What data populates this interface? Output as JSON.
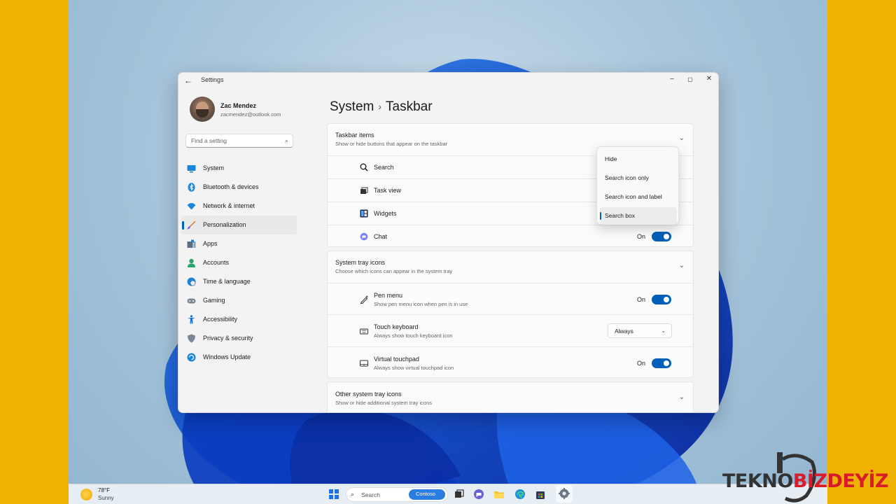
{
  "window": {
    "title": "Settings",
    "controls": {
      "minimize": "–",
      "maximize": "▢",
      "close": "✕"
    }
  },
  "profile": {
    "name": "Zac Mendez",
    "email": "zacmendez@outlook.com"
  },
  "search": {
    "placeholder": "Find a setting"
  },
  "nav": [
    {
      "label": "System",
      "icon": "system-icon",
      "color": "#1a86d9"
    },
    {
      "label": "Bluetooth & devices",
      "icon": "bluetooth-icon",
      "color": "#1a86d9"
    },
    {
      "label": "Network & internet",
      "icon": "network-icon",
      "color": "#1a86d9"
    },
    {
      "label": "Personalization",
      "icon": "brush-icon",
      "color": "#e07a2a",
      "active": true
    },
    {
      "label": "Apps",
      "icon": "apps-icon",
      "color": "#5a6f86"
    },
    {
      "label": "Accounts",
      "icon": "accounts-icon",
      "color": "#2aa56b"
    },
    {
      "label": "Time & language",
      "icon": "globe-clock-icon",
      "color": "#1a86d9"
    },
    {
      "label": "Gaming",
      "icon": "gamepad-icon",
      "color": "#7a8794"
    },
    {
      "label": "Accessibility",
      "icon": "accessibility-icon",
      "color": "#1a6fd9"
    },
    {
      "label": "Privacy & security",
      "icon": "shield-icon",
      "color": "#7a8794"
    },
    {
      "label": "Windows Update",
      "icon": "update-icon",
      "color": "#1a86d9"
    }
  ],
  "breadcrumb": {
    "parent": "System",
    "separator": "›",
    "current": "Taskbar"
  },
  "sections": {
    "taskbar_items": {
      "title": "Taskbar items",
      "subtitle": "Show or hide buttons that appear on the taskbar",
      "rows": [
        {
          "label": "Search",
          "icon": "search-icon"
        },
        {
          "label": "Task view",
          "icon": "task-view-icon"
        },
        {
          "label": "Widgets",
          "icon": "widgets-icon"
        },
        {
          "label": "Chat",
          "icon": "chat-icon",
          "state": "On"
        }
      ]
    },
    "system_tray": {
      "title": "System tray icons",
      "subtitle": "Choose which icons can appear in the system tray",
      "rows": [
        {
          "label": "Pen menu",
          "sub": "Show pen menu icon when pen is in use",
          "icon": "pen-icon",
          "state": "On"
        },
        {
          "label": "Touch keyboard",
          "sub": "Always show touch keyboard icon",
          "icon": "keyboard-icon",
          "select": "Always"
        },
        {
          "label": "Virtual touchpad",
          "sub": "Always show virtual touchpad icon",
          "icon": "touchpad-icon",
          "state": "On"
        }
      ]
    },
    "other_tray": {
      "title": "Other system tray icons",
      "subtitle": "Show or hide additional system tray icons"
    }
  },
  "dropdown": {
    "options": [
      "Hide",
      "Search icon only",
      "Search icon and label",
      "Search box"
    ],
    "selected": "Search box"
  },
  "taskbar": {
    "weather": {
      "temp": "78°F",
      "condition": "Sunny"
    },
    "search_text": "Search",
    "contoso": "Contoso",
    "apps": [
      "task-view-icon",
      "teams-chat-icon",
      "file-explorer-icon",
      "edge-icon",
      "store-icon",
      "settings-icon"
    ]
  },
  "brand": {
    "part1": "TEKNO",
    "part2": "BİZDEYİZ"
  },
  "colors": {
    "accent": "#005fb8",
    "frame": "#F0B200",
    "brand_red": "#d81c2a"
  }
}
